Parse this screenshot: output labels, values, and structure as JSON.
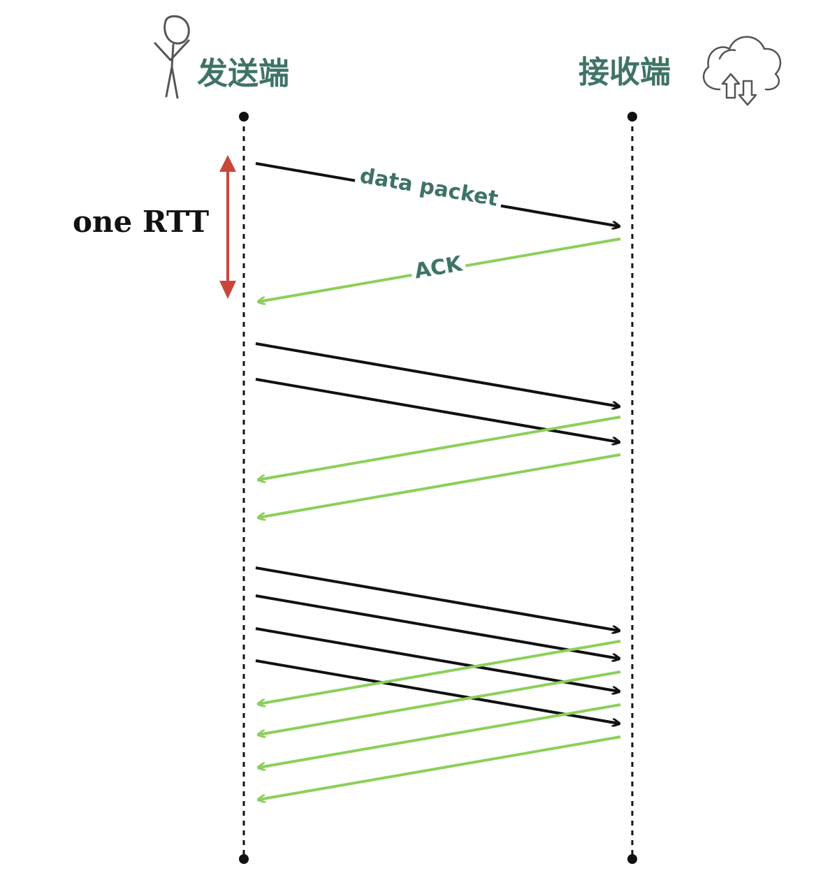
{
  "sender": {
    "label": "发送端",
    "icon": "stick-figure-icon"
  },
  "receiver": {
    "label": "接收端",
    "icon": "cloud-upload-download-icon"
  },
  "rtt_label": "one RTT",
  "data_packet_label": "data packet",
  "ack_label": "ACK",
  "colors": {
    "data_arrow": "#111111",
    "ack_arrow": "#8ccf5a",
    "rtt_marker": "#c8473a",
    "label_text": "#3f7367",
    "timeline": "#111111"
  },
  "rounds": [
    {
      "round": 1,
      "data_packets": 1,
      "acks": 1
    },
    {
      "round": 2,
      "data_packets": 2,
      "acks": 2
    },
    {
      "round": 3,
      "data_packets": 4,
      "acks": 4
    }
  ]
}
